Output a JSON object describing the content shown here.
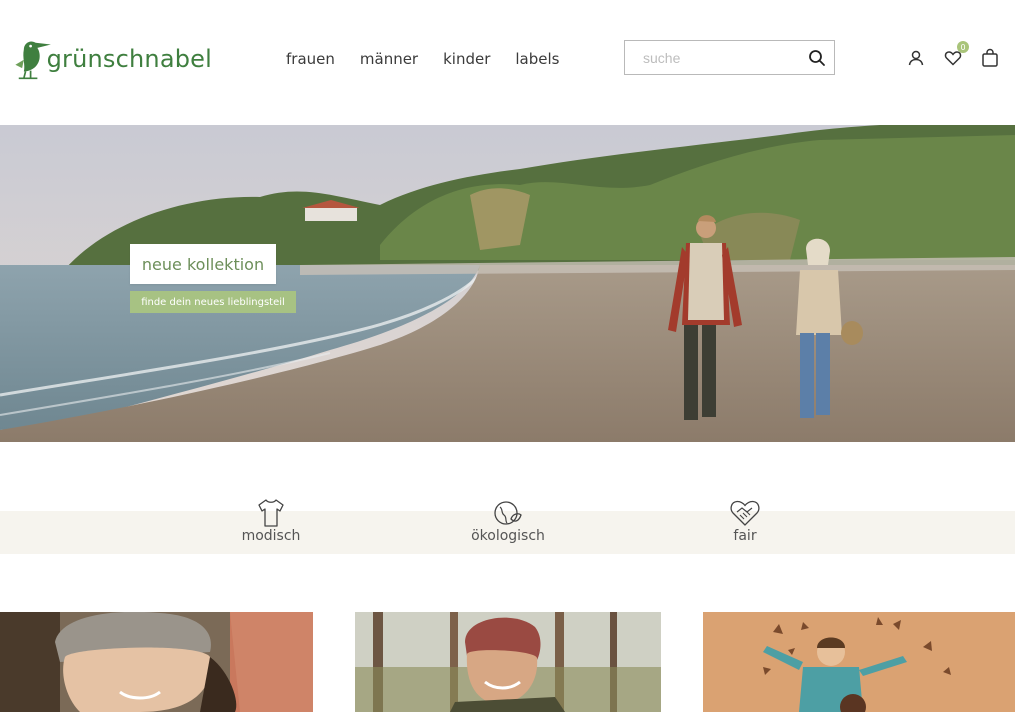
{
  "brand": {
    "name": "grünschnabel"
  },
  "nav": {
    "items": [
      "frauen",
      "männer",
      "kinder",
      "labels"
    ]
  },
  "search": {
    "placeholder": "suche"
  },
  "header_icons": {
    "account": "user-icon",
    "wishlist": "heart-icon",
    "wishlist_count": "0",
    "cart": "shopping-bag-icon"
  },
  "hero": {
    "title": "neue kollektion",
    "cta": "finde dein neues lieblingsteil"
  },
  "values": [
    {
      "icon": "tshirt-icon",
      "label": "modisch"
    },
    {
      "icon": "globe-leaf-icon",
      "label": "ökologisch"
    },
    {
      "icon": "heart-handshake-icon",
      "label": "fair"
    }
  ],
  "colors": {
    "brand_green": "#3f7f3f",
    "accent_green": "#a7c283",
    "band_beige": "#f6f4ee"
  }
}
